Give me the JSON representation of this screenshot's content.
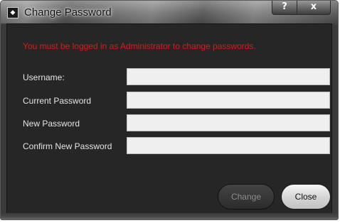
{
  "window": {
    "title": "Change Password",
    "icon": "app-logo-icon",
    "help_label": "?",
    "close_label": "x"
  },
  "message": {
    "error": "You must be logged in as Administrator to change passwords.",
    "color": "#e01818"
  },
  "form": {
    "username_label": "Username:",
    "username_value": "",
    "current_password_label": "Current Password",
    "current_password_value": "",
    "new_password_label": "New Password",
    "new_password_value": "",
    "confirm_password_label": "Confirm New Password",
    "confirm_password_value": ""
  },
  "buttons": {
    "change_label": "Change",
    "change_enabled": false,
    "close_label": "Close"
  }
}
